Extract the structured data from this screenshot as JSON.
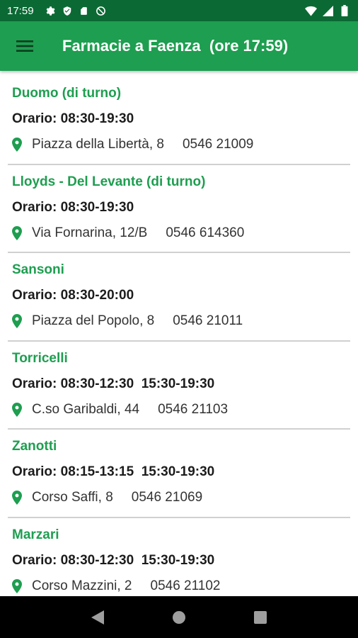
{
  "status_bar": {
    "time": "17:59",
    "icons_left": [
      "gear-icon",
      "shield-icon",
      "sd-card-icon",
      "no-disturb-icon"
    ],
    "icons_right": [
      "wifi-icon",
      "signal-icon",
      "battery-icon"
    ]
  },
  "app_bar": {
    "title": "Farmacie a Faenza  (ore 17:59)",
    "menu_icon": "hamburger-menu-icon",
    "background": "#1e9e50"
  },
  "colors": {
    "status_bar": "#0b6a34",
    "accent": "#1e9e50",
    "divider": "#d0d0d0"
  },
  "pharmacies": [
    {
      "name": "Duomo (di turno)",
      "hours": "Orario: 08:30-19:30",
      "address": "Piazza della Libertà, 8",
      "phone": "0546 21009"
    },
    {
      "name": "Lloyds - Del Levante (di turno)",
      "hours": "Orario: 08:30-19:30",
      "address": "Via Fornarina, 12/B",
      "phone": "0546 614360"
    },
    {
      "name": "Sansoni",
      "hours": "Orario: 08:30-20:00",
      "address": "Piazza del Popolo, 8",
      "phone": "0546 21011"
    },
    {
      "name": "Torricelli",
      "hours": "Orario: 08:30-12:30  15:30-19:30",
      "address": "C.so Garibaldi, 44",
      "phone": "0546 21103"
    },
    {
      "name": "Zanotti",
      "hours": "Orario: 08:15-13:15  15:30-19:30",
      "address": "Corso Saffi, 8",
      "phone": "0546 21069"
    },
    {
      "name": "Marzari",
      "hours": "Orario: 08:30-12:30  15:30-19:30",
      "address": "Corso Mazzini, 2",
      "phone": "0546 21102"
    }
  ],
  "nav_bar": {
    "buttons": [
      "back-icon",
      "home-icon",
      "recents-icon"
    ]
  }
}
